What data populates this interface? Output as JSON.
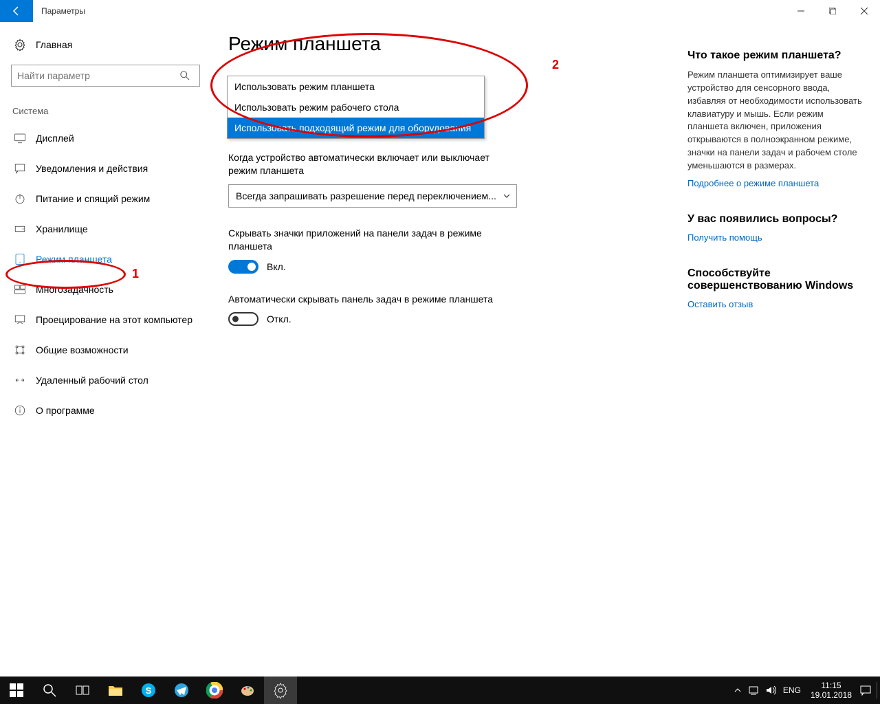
{
  "titlebar": {
    "title": "Параметры"
  },
  "sidebar": {
    "home": "Главная",
    "search_placeholder": "Найти параметр",
    "group": "Система",
    "items": [
      {
        "label": "Дисплей"
      },
      {
        "label": "Уведомления и действия"
      },
      {
        "label": "Питание и спящий режим"
      },
      {
        "label": "Хранилище"
      },
      {
        "label": "Режим планшета"
      },
      {
        "label": "Многозадачность"
      },
      {
        "label": "Проецирование на этот компьютер"
      },
      {
        "label": "Общие возможности"
      },
      {
        "label": "Удаленный рабочий стол"
      },
      {
        "label": "О программе"
      }
    ]
  },
  "main": {
    "page_title": "Режим планшета",
    "dropdown1": {
      "options": [
        "Использовать режим планшета",
        "Использовать режим рабочего стола",
        "Использовать подходящий режим для оборудования"
      ]
    },
    "setting2_label": "Когда устройство автоматически включает или выключает режим планшета",
    "select2_value": "Всегда запрашивать разрешение перед переключением...",
    "setting3_label": "Скрывать значки приложений на панели задач в режиме планшета",
    "toggle_on": "Вкл.",
    "setting4_label": "Автоматически скрывать панель задач в режиме планшета",
    "toggle_off": "Откл."
  },
  "rightpane": {
    "q1_heading": "Что такое режим планшета?",
    "q1_text": "Режим планшета оптимизирует ваше устройство для сенсорного ввода, избавляя от необходимости использовать клавиатуру и мышь. Если режим планшета включен, приложения открываются в полноэкранном режиме, значки на панели задач и рабочем столе уменьшаются в размерах.",
    "q1_link": "Подробнее о режиме планшета",
    "q2_heading": "У вас появились вопросы?",
    "q2_link": "Получить помощь",
    "q3_heading": "Способствуйте совершенствованию Windows",
    "q3_link": "Оставить отзыв"
  },
  "annotations": {
    "one": "1",
    "two": "2"
  },
  "taskbar": {
    "lang": "ENG",
    "time": "11:15",
    "date": "19.01.2018"
  }
}
